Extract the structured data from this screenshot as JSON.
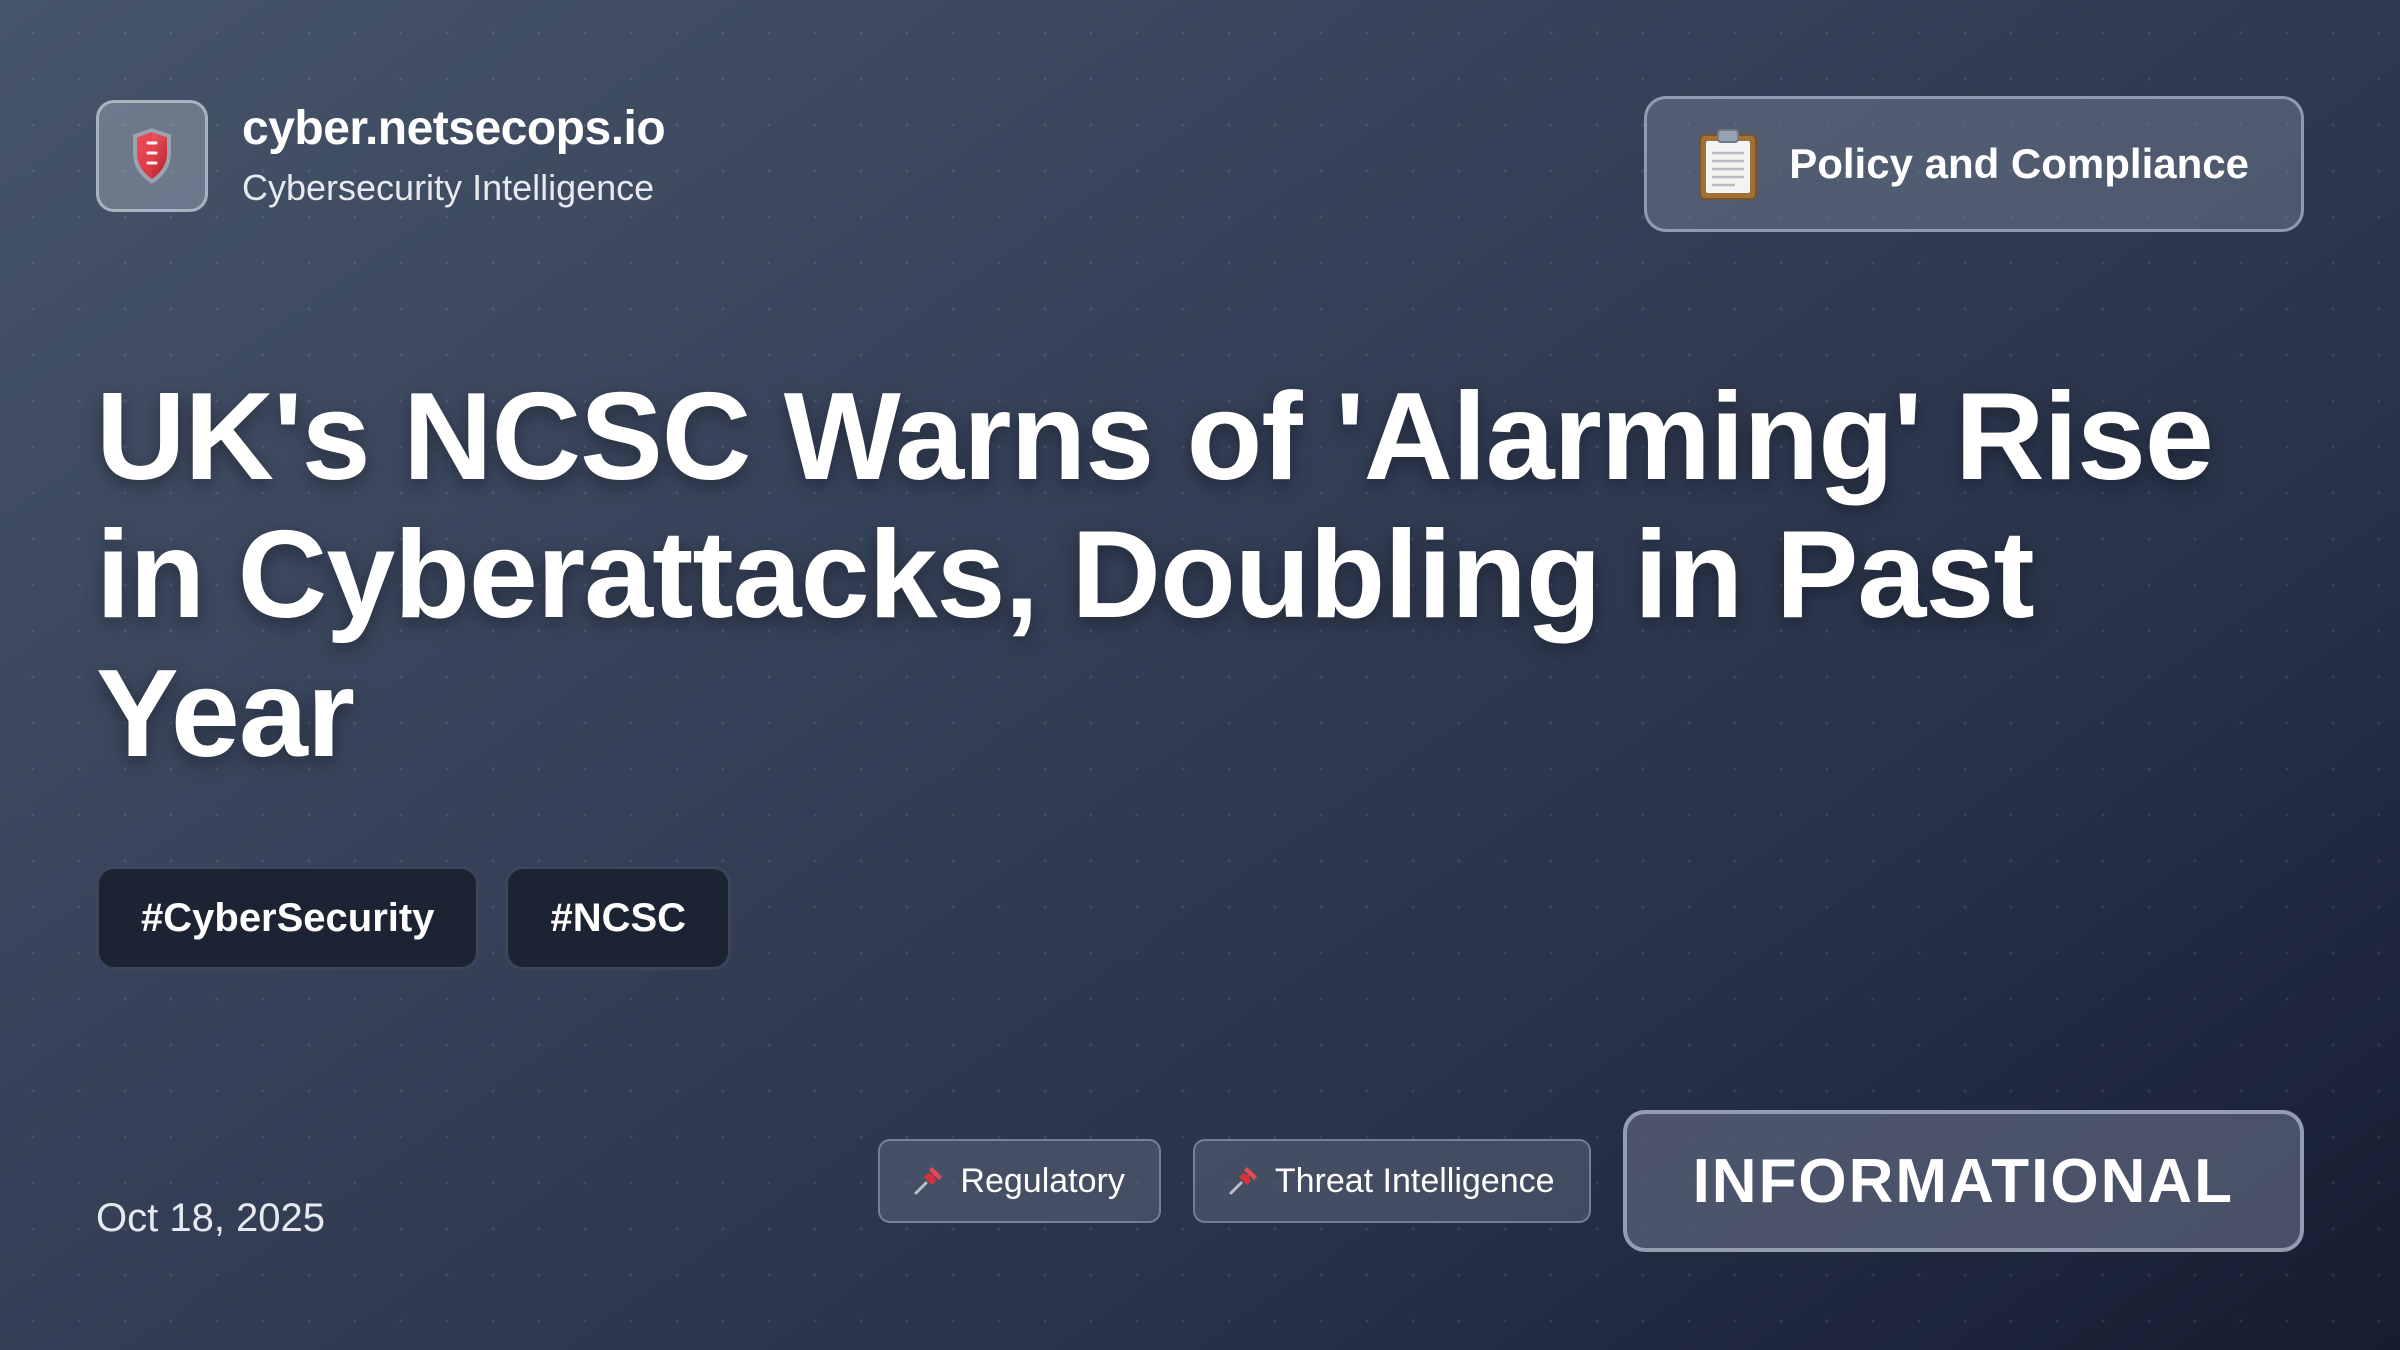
{
  "brand": {
    "domain": "cyber.netsecops.io",
    "tagline": "Cybersecurity Intelligence",
    "logo_icon": "shield-icon"
  },
  "category": {
    "label": "Policy and Compliance",
    "icon": "clipboard-icon"
  },
  "headline": {
    "line1": "UK's NCSC Warns of 'Alarming' Rise",
    "line2": "in Cyberattacks, Doubling in Past",
    "line3": "Year"
  },
  "hashtags": [
    "#CyberSecurity",
    "#NCSC"
  ],
  "date": "Oct 18, 2025",
  "topics": [
    {
      "label": "Regulatory",
      "icon": "pushpin-icon"
    },
    {
      "label": "Threat Intelligence",
      "icon": "pushpin-icon"
    }
  ],
  "severity": {
    "label": "INFORMATIONAL"
  },
  "colors": {
    "background_start": "#465468",
    "background_end": "#151d30",
    "tag_background": "#1c2434",
    "pin_red": "#d9303c"
  }
}
